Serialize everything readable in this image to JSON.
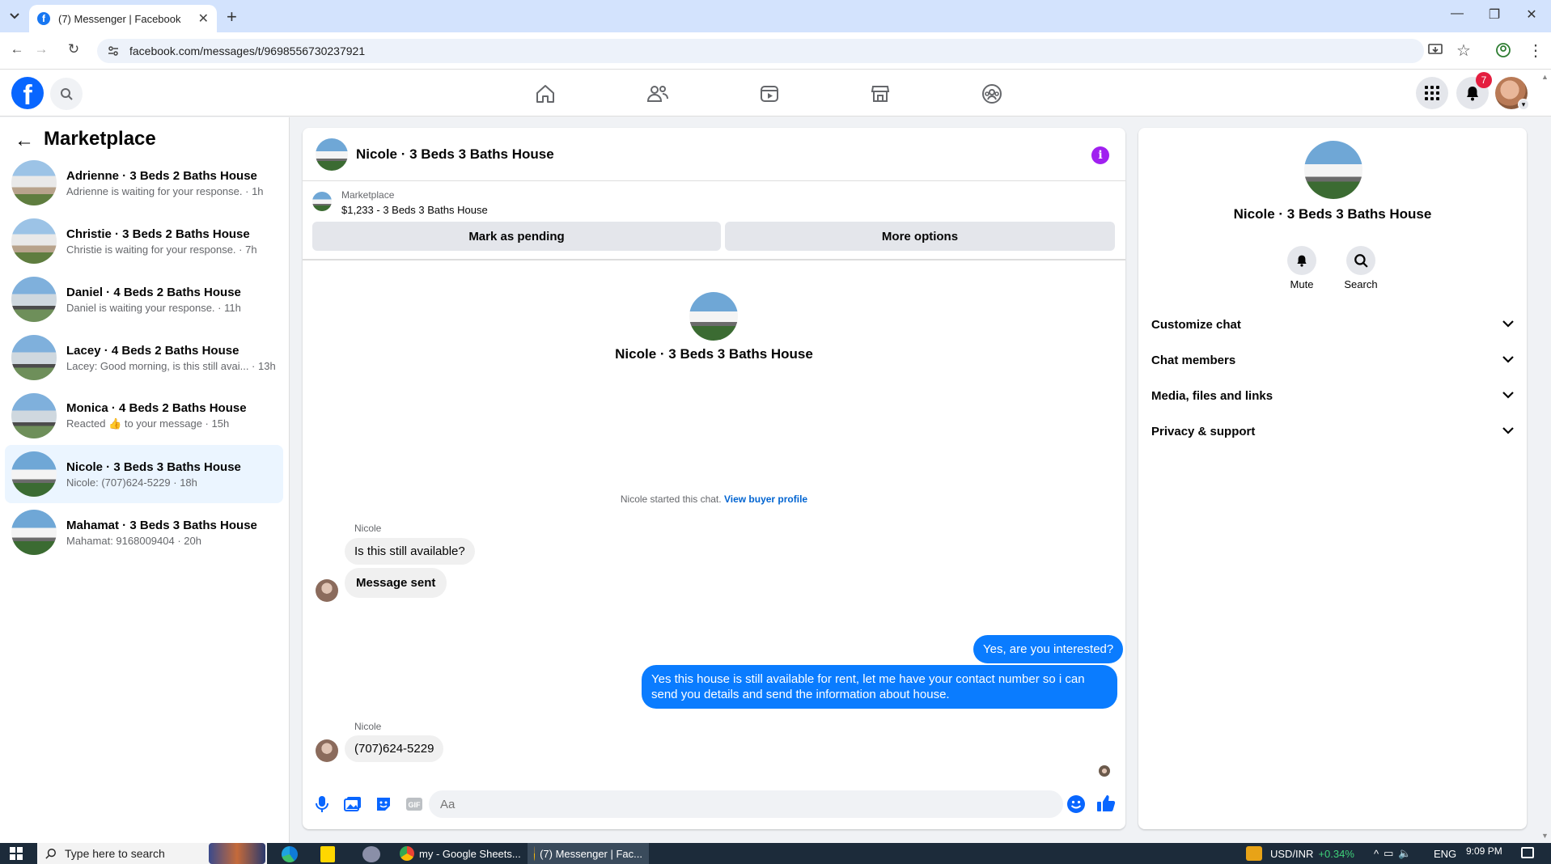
{
  "browser": {
    "tab_title": "(7) Messenger | Facebook",
    "url": "facebook.com/messages/t/9698556730237921"
  },
  "header": {
    "notification_count": "7",
    "nav_icons": [
      "home-icon",
      "friends-icon",
      "video-icon",
      "marketplace-icon",
      "groups-icon"
    ]
  },
  "sidebar": {
    "title": "Marketplace",
    "conversations": [
      {
        "name": "Adrienne · 3 Beds 2 Baths House",
        "preview": "Adrienne is waiting for your response.",
        "time": "1h"
      },
      {
        "name": "Christie · 3 Beds 2 Baths House",
        "preview": "Christie is waiting for your response.",
        "time": "7h"
      },
      {
        "name": "Daniel · 4 Beds 2 Baths House",
        "preview": "Daniel is waiting your response.",
        "time": "11h"
      },
      {
        "name": "Lacey · 4 Beds 2 Baths House",
        "preview": "Lacey: Good morning, is this still avai...",
        "time": "13h"
      },
      {
        "name": "Monica · 4 Beds 2 Baths House",
        "preview": "Reacted 👍 to your message",
        "time": "15h"
      },
      {
        "name": "Nicole · 3 Beds 3 Baths House",
        "preview": "Nicole: (707)624-5229",
        "time": "18h",
        "selected": true
      },
      {
        "name": "Mahamat · 3 Beds 3 Baths House",
        "preview": "Mahamat: 9168009404",
        "time": "20h"
      }
    ]
  },
  "chat": {
    "title": "Nicole · 3 Beds 3 Baths House",
    "listing_label": "Marketplace",
    "listing_price": "$1,233 - 3 Beds 3 Baths House",
    "mark_pending": "Mark as pending",
    "more_options": "More options",
    "intro_name": "Nicole · 3 Beds 3 Baths House",
    "started_text": "Nicole started this chat.",
    "buyer_profile_link": "View buyer profile",
    "messages": [
      {
        "sender": "Nicole",
        "text": "Is this still available?"
      },
      {
        "text": "Message sent"
      },
      {
        "out": true,
        "text": "Yes, are you interested?"
      },
      {
        "out": true,
        "text": "Yes this house is still available for rent, let me have your contact number so i can send you details and send the information about house."
      },
      {
        "sender": "Nicole",
        "text": "(707)624-5229"
      }
    ],
    "input_placeholder": "Aa"
  },
  "details": {
    "name": "Nicole · 3 Beds 3 Baths House",
    "mute": "Mute",
    "search": "Search",
    "sections": [
      "Customize chat",
      "Chat members",
      "Media, files and links",
      "Privacy & support"
    ]
  },
  "taskbar": {
    "search_placeholder": "Type here to search",
    "apps": [
      "my - Google Sheets...",
      "(7) Messenger | Fac..."
    ],
    "ticker": "USD/INR",
    "ticker_change": "+0.34%",
    "lang": "ENG",
    "time": "9:09 PM"
  },
  "colors": {
    "brand": "#0866ff",
    "bubble_out": "#0a7cff",
    "link": "#0064d1"
  }
}
